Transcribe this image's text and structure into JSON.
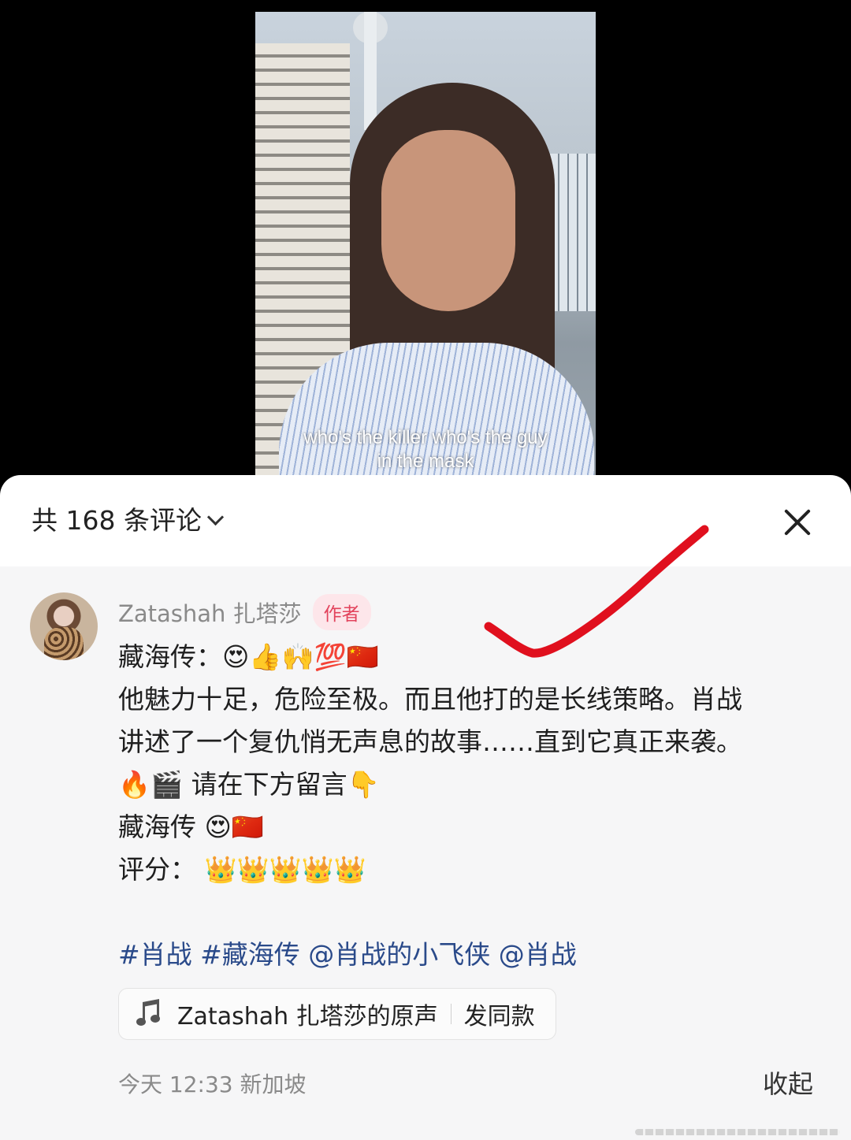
{
  "video": {
    "subtitle_line1": "who's the killer who's the guy",
    "subtitle_line2": "in the mask"
  },
  "panel": {
    "comment_count_label": "共 168 条评论",
    "close_icon": "close-icon"
  },
  "comment": {
    "author": "Zatashah 扎塔莎",
    "author_badge": "作者",
    "lines": [
      "藏海传：😍👍🙌💯🇨🇳",
      "他魅力十足，危险至极。而且他打的是长线策略。肖战",
      "讲述了一个复仇悄无声息的故事……直到它真正来袭。",
      "🔥🎬 请在下方留言👇",
      "藏海传 😍🇨🇳",
      "评分： 👑👑👑👑👑"
    ],
    "tags": "#肖战 #藏海传 @肖战的小飞侠 @肖战",
    "sound_label": "Zatashah 扎塔莎的原声",
    "sound_action": "发同款",
    "meta": "今天 12:33 新加坡",
    "collapse_label": "收起"
  },
  "annotation": {
    "color": "#e0101e"
  }
}
